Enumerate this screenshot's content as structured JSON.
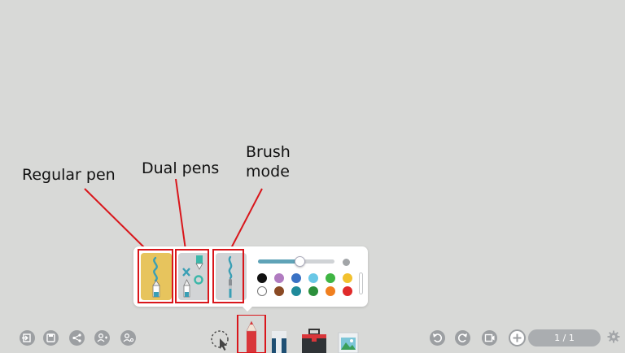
{
  "annotations": {
    "regular_pen": "Regular pen",
    "dual_pens": "Dual pens",
    "brush_mode": "Brush mode"
  },
  "pen_panel": {
    "modes": [
      {
        "name": "regular-pen",
        "selected": true
      },
      {
        "name": "dual-pens",
        "selected": false
      },
      {
        "name": "brush-mode",
        "selected": false
      }
    ],
    "thickness_slider": {
      "value_fraction": 0.55
    },
    "colors": [
      "#111111",
      "#b07bc0",
      "#3a72c4",
      "#69c7e6",
      "#3fb543",
      "#f2c12e",
      "#ffffff",
      "#8a4a24",
      "#1f8a9a",
      "#2b8f3b",
      "#f07f1f",
      "#e02a2a"
    ]
  },
  "toolbar": {
    "left_icons": [
      "exit-icon",
      "save-icon",
      "share-icon",
      "add-user-icon",
      "user-settings-icon"
    ],
    "center_tools": [
      "lasso-select-icon",
      "pen-tool-icon",
      "eraser-icon",
      "toolbox-icon",
      "image-icon"
    ],
    "right_icons": [
      "undo-icon",
      "redo-icon",
      "present-icon",
      "add-page-icon",
      "settings-gear-icon"
    ],
    "page_indicator": "1 / 1"
  },
  "colors": {
    "background": "#d8d9d7",
    "highlight_red": "#d9161b",
    "accent_teal": "#5fa3b7",
    "regular_pen_bg": "#e7c45d"
  }
}
